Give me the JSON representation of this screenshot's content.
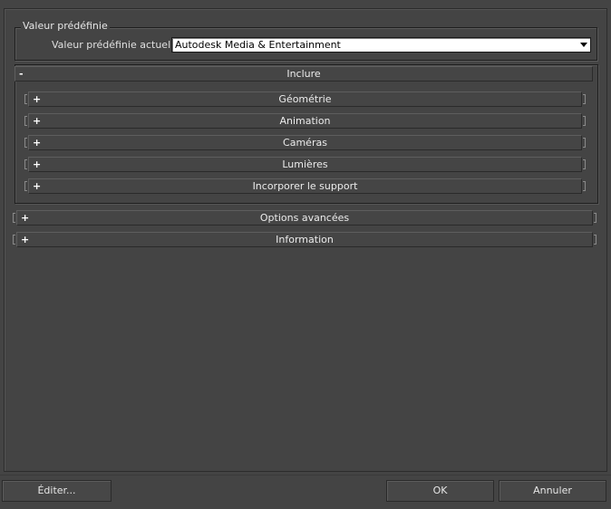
{
  "preset_group": {
    "title": "Valeur prédéfinie",
    "current_label": "Valeur prédéfinie actuelle:",
    "current_value": "Autodesk Media & Entertainment"
  },
  "include": {
    "label": "Inclure",
    "toggle": "-",
    "items": [
      {
        "label": "Géométrie",
        "toggle": "+"
      },
      {
        "label": "Animation",
        "toggle": "+"
      },
      {
        "label": "Caméras",
        "toggle": "+"
      },
      {
        "label": "Lumières",
        "toggle": "+"
      },
      {
        "label": "Incorporer le support",
        "toggle": "+"
      }
    ]
  },
  "advanced": {
    "label": "Options avancées",
    "toggle": "+"
  },
  "information": {
    "label": "Information",
    "toggle": "+"
  },
  "buttons": {
    "edit": "Éditer...",
    "ok": "OK",
    "cancel": "Annuler"
  }
}
